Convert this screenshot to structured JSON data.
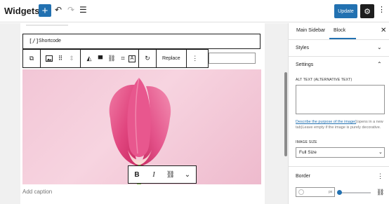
{
  "header": {
    "title": "Widgets",
    "add_icon": "+",
    "undo_icon": "↶",
    "redo_icon": "↷",
    "list_view_icon": "☰",
    "update_label": "Update",
    "settings_icon": "⚙",
    "more_icon": "⋮"
  },
  "colors": {
    "accent": "#2271b1",
    "dark": "#1e1e1e",
    "image_background": "#f4cad9",
    "petal": "#e8578e"
  },
  "shortcode": {
    "icon": "[/]",
    "label": "Shortcode"
  },
  "block_toolbar": {
    "transform_icon": "⧉",
    "image_icon": "🖼",
    "drag_icon": "⠿",
    "move_icon": "⇕",
    "duotone_icon": "◭",
    "align_icon": "▀",
    "link_icon": "⛓",
    "crop_icon": "⌗",
    "text_overlay_icon": "A",
    "rotate_icon": "↻",
    "replace_label": "Replace",
    "options_icon": "⋮"
  },
  "format_toolbar": {
    "bold_label": "B",
    "italic_label": "I",
    "link_icon": "⛓",
    "more_icon": "⌄"
  },
  "caption_placeholder": "Add caption",
  "sidebar": {
    "tabs": [
      "Main Sidebar",
      "Block"
    ],
    "active_tab": "Block",
    "close_icon": "✕",
    "styles_label": "Styles",
    "styles_chevron": "⌄",
    "settings_label": "Settings",
    "settings_chevron": "⌃",
    "alt_text_label": "ALT TEXT (ALTERNATIVE TEXT)",
    "alt_text_value": "",
    "help_link": "Describe the purpose of the image(",
    "help_text": "(opens in a new tab)Leave empty if the image is purely decorative.",
    "image_size_label": "IMAGE SIZE",
    "image_size_value": "Full Size",
    "select_arrow": "⌄",
    "border_label": "Border",
    "border_options_icon": "⋮",
    "radius_unit": "px",
    "radius_value": "",
    "radius_slider_fraction": 0,
    "unlink_icon": "⛓"
  }
}
